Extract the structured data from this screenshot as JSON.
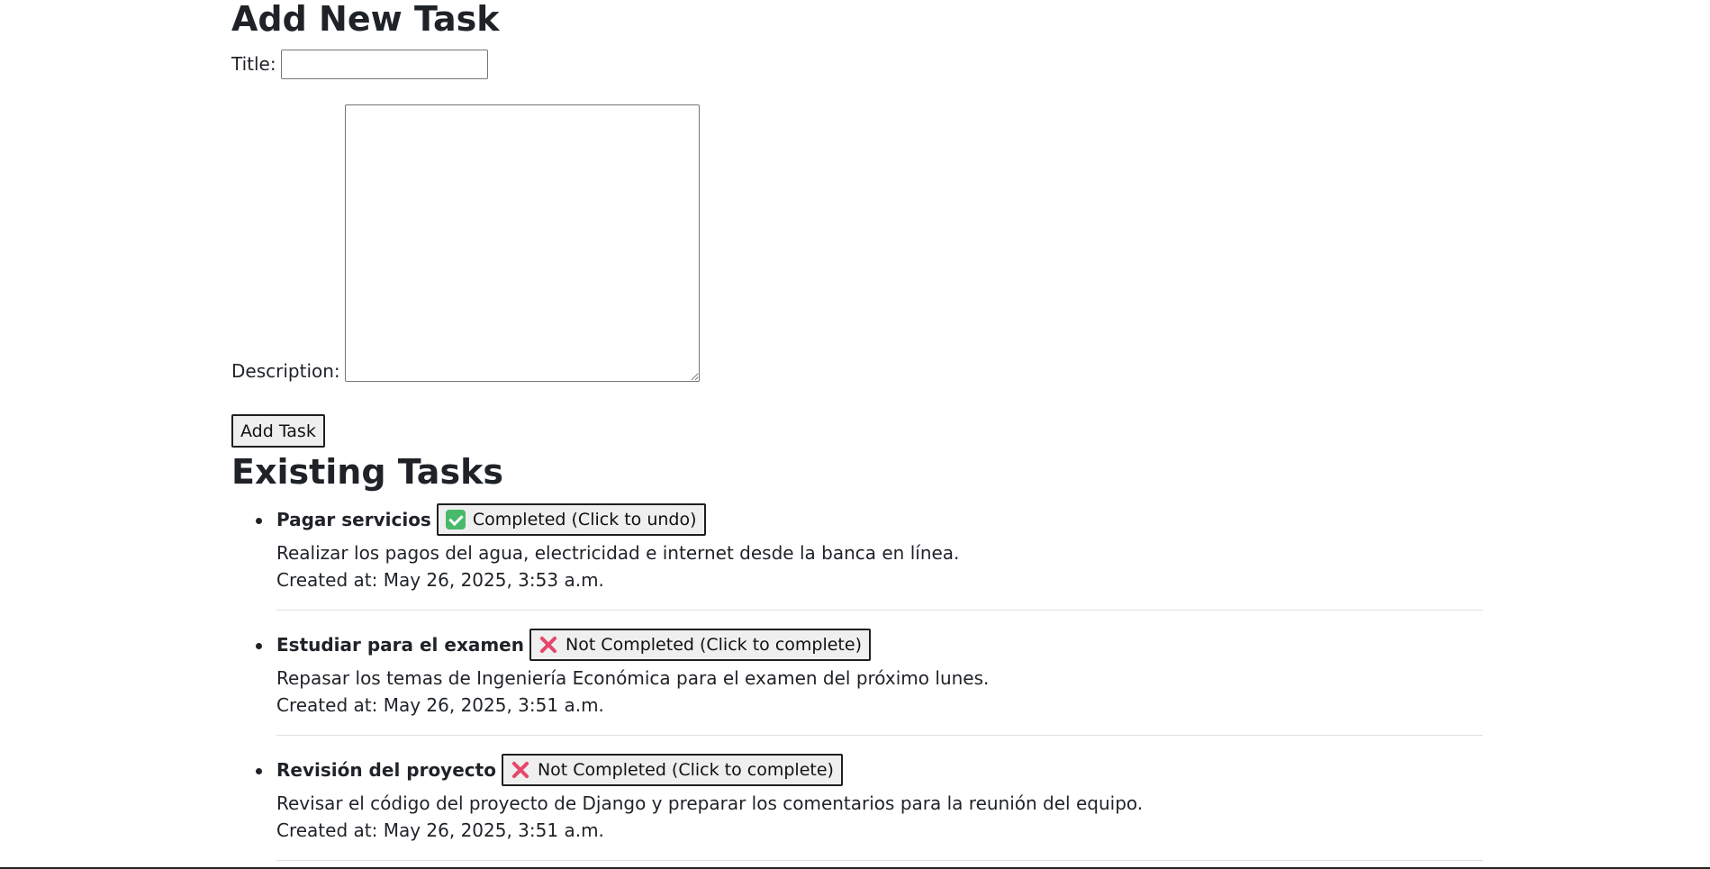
{
  "form": {
    "heading": "Add New Task",
    "title_label": "Title:",
    "title_value": "",
    "description_label": "Description:",
    "description_value": "",
    "submit_label": "Add Task"
  },
  "list": {
    "heading": "Existing Tasks",
    "created_prefix": "Created at:",
    "tasks": [
      {
        "title": "Pagar servicios",
        "status": "completed",
        "status_label": "Completed (Click to undo)",
        "status_icon": "check-mark-icon",
        "description": "Realizar los pagos del agua, electricidad e internet desde la banca en línea.",
        "created": "Created at: May 26, 2025, 3:53 a.m."
      },
      {
        "title": "Estudiar para el examen",
        "status": "not-completed",
        "status_label": "Not Completed (Click to complete)",
        "status_icon": "cross-mark-icon",
        "description": "Repasar los temas de Ingeniería Económica para el examen del próximo lunes.",
        "created": "Created at: May 26, 2025, 3:51 a.m."
      },
      {
        "title": "Revisión del proyecto",
        "status": "not-completed",
        "status_label": "Not Completed (Click to complete)",
        "status_icon": "cross-mark-icon",
        "description": "Revisar el código del proyecto de Django y preparar los comentarios para la reunión del equipo.",
        "created": "Created at: May 26, 2025, 3:51 a.m."
      }
    ]
  },
  "colors": {
    "completed_icon": "#48b96b",
    "not_completed_icon": "#e6476a",
    "button_bg": "#efefef"
  }
}
